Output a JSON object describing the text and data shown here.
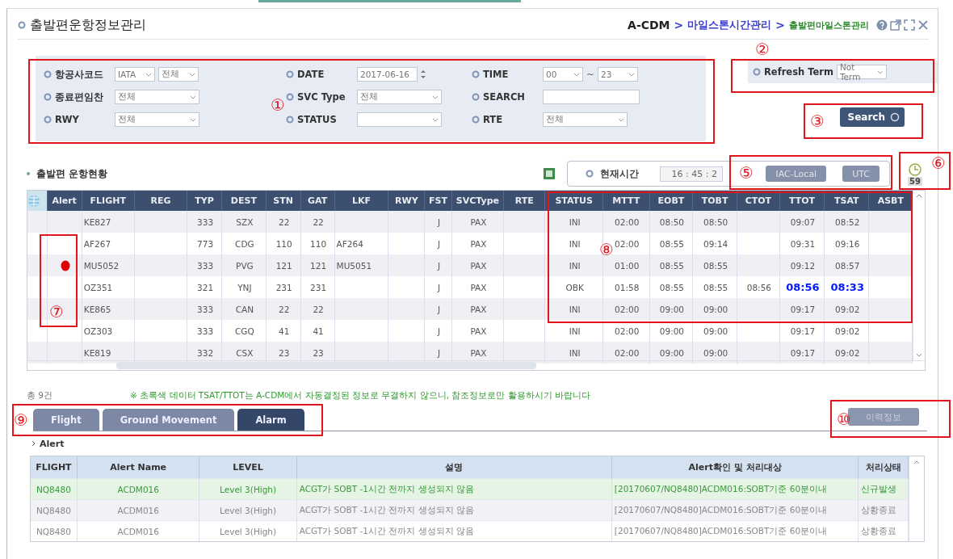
{
  "header": {
    "title": "출발편운항정보관리",
    "breadcrumb": [
      "A-CDM",
      "마일스톤시간관리",
      "출발편마일스톤관리"
    ],
    "separator": ">"
  },
  "filters": [
    {
      "label": "항공사코드",
      "controls": [
        {
          "kind": "select",
          "value": "IATA"
        },
        {
          "kind": "select",
          "value": "전체"
        }
      ]
    },
    {
      "label": "DATE",
      "controls": [
        {
          "kind": "date",
          "value": "2017-06-16"
        }
      ]
    },
    {
      "label": "TIME",
      "controls": [
        {
          "kind": "select",
          "value": "00"
        },
        {
          "kind": "sep",
          "value": "~"
        },
        {
          "kind": "select",
          "value": "23"
        }
      ]
    },
    {
      "label": "종료편임찬",
      "controls": [
        {
          "kind": "select",
          "value": "전체"
        }
      ]
    },
    {
      "label": "SVC Type",
      "controls": [
        {
          "kind": "select",
          "value": "전체"
        }
      ]
    },
    {
      "label": "SEARCH",
      "controls": [
        {
          "kind": "text"
        }
      ]
    },
    {
      "label": "RWY",
      "controls": [
        {
          "kind": "select",
          "value": "전체"
        }
      ]
    },
    {
      "label": "STATUS",
      "controls": [
        {
          "kind": "select"
        }
      ]
    },
    {
      "label": "RTE",
      "controls": [
        {
          "kind": "select",
          "value": "전체"
        }
      ]
    }
  ],
  "refresh": {
    "label": "Refresh Term",
    "value": "Not Term"
  },
  "search_button": "Search",
  "flights": {
    "title": "출발편 운항현황",
    "current_time_label": "현재시간",
    "current_time": "16 : 45 : 2",
    "buttons": [
      "IAC-Local",
      "UTC"
    ],
    "timer": "59",
    "columns": [
      "Alert",
      "FLIGHT",
      "REG",
      "TYP",
      "DEST",
      "STN",
      "GAT",
      "LKF",
      "RWY",
      "FST",
      "SVCType",
      "RTE",
      "STATUS",
      "MTTT",
      "EOBT",
      "TOBT",
      "CTOT",
      "TTOT",
      "TSAT",
      "ASBT"
    ],
    "rows": [
      {
        "alert": false,
        "emphasized": false,
        "cells": [
          "",
          "KE827",
          "",
          "333",
          "SZX",
          "22",
          "22",
          "",
          "",
          "J",
          "PAX",
          "",
          "INI",
          "02:00",
          "08:50",
          "08:50",
          "",
          "09:07",
          "08:52",
          ""
        ]
      },
      {
        "alert": false,
        "emphasized": false,
        "cells": [
          "",
          "AF267",
          "",
          "773",
          "CDG",
          "110",
          "110",
          "AF264",
          "",
          "J",
          "PAX",
          "",
          "INI",
          "02:00",
          "08:55",
          "09:14",
          "",
          "09:31",
          "09:16",
          ""
        ]
      },
      {
        "alert": true,
        "emphasized": false,
        "cells": [
          "",
          "MU5052",
          "",
          "333",
          "PVG",
          "121",
          "121",
          "MU5051",
          "",
          "J",
          "PAX",
          "",
          "INI",
          "01:00",
          "08:55",
          "08:55",
          "",
          "09:12",
          "08:57",
          ""
        ]
      },
      {
        "alert": false,
        "emphasized": true,
        "cells": [
          "",
          "OZ351",
          "",
          "321",
          "YNJ",
          "231",
          "231",
          "",
          "",
          "J",
          "PAX",
          "",
          "OBK",
          "01:58",
          "08:55",
          "08:55",
          "08:56",
          "08:56",
          "08:33",
          ""
        ]
      },
      {
        "alert": false,
        "emphasized": false,
        "cells": [
          "",
          "KE865",
          "",
          "333",
          "CAN",
          "22",
          "22",
          "",
          "",
          "J",
          "PAX",
          "",
          "INI",
          "02:00",
          "09:00",
          "09:00",
          "",
          "09:17",
          "09:02",
          ""
        ]
      },
      {
        "alert": false,
        "emphasized": false,
        "cells": [
          "",
          "OZ303",
          "",
          "333",
          "CGQ",
          "41",
          "41",
          "",
          "",
          "J",
          "PAX",
          "",
          "INI",
          "02:00",
          "09:00",
          "09:00",
          "",
          "09:17",
          "09:02",
          ""
        ]
      },
      {
        "alert": false,
        "emphasized": false,
        "cells": [
          "",
          "KE819",
          "",
          "332",
          "CSX",
          "23",
          "23",
          "",
          "",
          "J",
          "PAX",
          "",
          "INI",
          "02:00",
          "09:00",
          "09:00",
          "",
          "09:17",
          "09:02",
          ""
        ]
      }
    ]
  },
  "note": {
    "count": "총 9건",
    "message": "※ 초록색 데이터 TSAT/TTOT는 A-CDM에서 자동결정된 정보로 무결하지 않으니, 참조정보로만 활용하시기 바랍니다"
  },
  "tabs": [
    {
      "label": "Flight",
      "selected": false
    },
    {
      "label": "Ground Movement",
      "selected": false
    },
    {
      "label": "Alarm",
      "selected": true
    }
  ],
  "history_button": {
    "label": "이력정보",
    "disabled": true
  },
  "alerts": {
    "title": "Alert",
    "columns": [
      "FLIGHT",
      "Alert Name",
      "LEVEL",
      "설명",
      "Alert확인 및 처리대상",
      "처리상태"
    ],
    "rows": [
      {
        "selected": true,
        "cells": [
          "NQ8480",
          "ACDM016",
          "Level 3(High)",
          "ACGT가 SOBT -1시간 전까지 생성되지 않음",
          "[20170607/NQ8480]ACDM016:SOBT기준 60분이내",
          "신규발생"
        ]
      },
      {
        "selected": false,
        "cells": [
          "NQ8480",
          "ACDM016",
          "Level 3(High)",
          "ACGT가 SOBT -1시간 전까지 생성되지 않음",
          "[20170607/NQ8480]ACDM016:SOBT기준 60분이내",
          "상황종료"
        ]
      },
      {
        "selected": false,
        "cells": [
          "NQ8480",
          "ACDM016",
          "Level 3(High)",
          "ACGT가 SOBT -1시간 전까지 생성되지 않음",
          "[20170607/NQ8480]ACDM016:SOBT기준 60분이내",
          "상황종료"
        ]
      }
    ]
  },
  "annotations": [
    {
      "label": "①"
    },
    {
      "label": "②"
    },
    {
      "label": "③"
    },
    {
      "label": "⑤"
    },
    {
      "label": "⑥"
    },
    {
      "label": "⑦"
    },
    {
      "label": "⑧"
    },
    {
      "label": "⑨"
    },
    {
      "label": "⑩"
    }
  ]
}
